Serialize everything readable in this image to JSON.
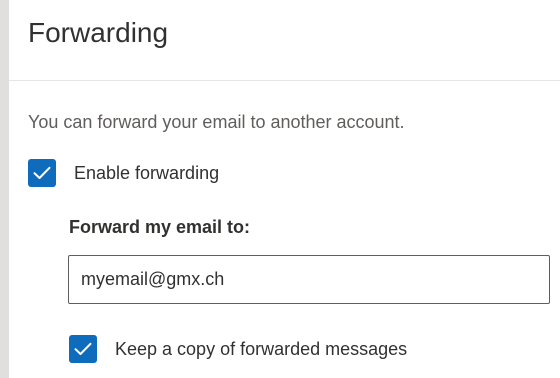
{
  "settings": {
    "title": "Forwarding",
    "description": "You can forward your email to another account.",
    "enable_forwarding": {
      "label": "Enable forwarding",
      "checked": true
    },
    "forward_to": {
      "label": "Forward my email to:",
      "value": "myemail@gmx.ch"
    },
    "keep_copy": {
      "label": "Keep a copy of forwarded messages",
      "checked": true
    }
  },
  "colors": {
    "accent": "#0f6cbd",
    "text": "#323130",
    "secondary_text": "#605e5c",
    "divider": "#e6e6e6",
    "side_strip": "#e1dfdd"
  },
  "icons": {
    "checkbox_mark": "checkmark-icon"
  }
}
